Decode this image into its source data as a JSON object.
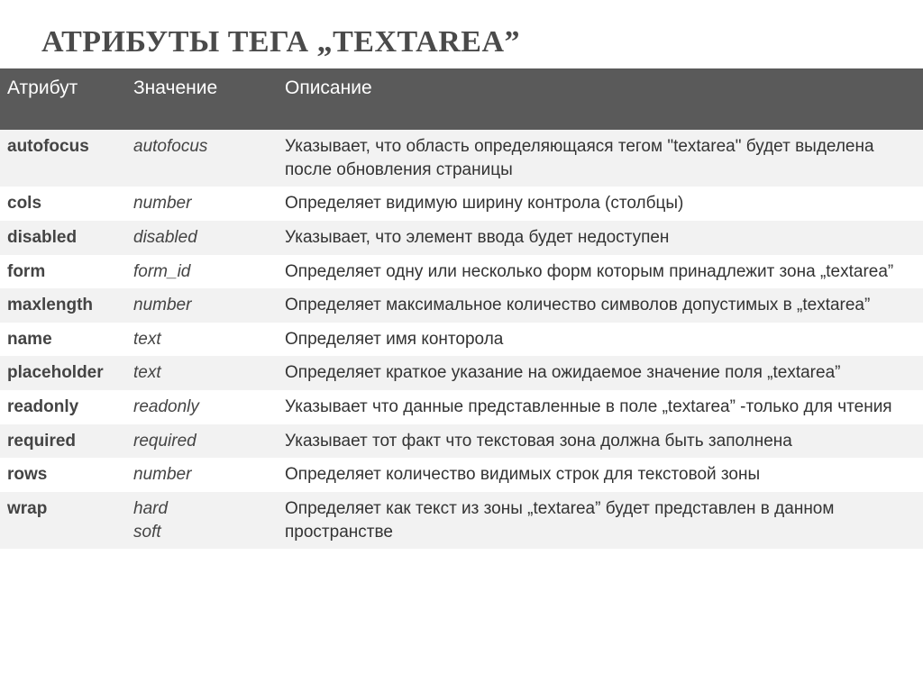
{
  "title": "АТРИБУТЫ ТЕГА „TEXTAREA”",
  "headers": {
    "attribute": "Атрибут",
    "value": "Значение",
    "description": "Описание"
  },
  "rows": [
    {
      "attribute": "autofocus",
      "value": "autofocus",
      "description": "Указывает, что область определяющаяся тегом \"textarea\" будет выделена после обновления страницы"
    },
    {
      "attribute": "cols",
      "value": "number",
      "description": "Определяет видимую ширину контрола (столбцы)"
    },
    {
      "attribute": "disabled",
      "value": "disabled",
      "description": "Указывает, что элемент ввода будет недоступен"
    },
    {
      "attribute": "form",
      "value": "form_id",
      "description": "Определяет одну или несколько форм которым принадлежит зона „textarea”"
    },
    {
      "attribute": "maxlength",
      "value": "number",
      "description": "Определяет максимальное количество символов допустимых в „textarea”"
    },
    {
      "attribute": "name",
      "value": "text",
      "description": "Определяет имя конторола"
    },
    {
      "attribute": "placeholder",
      "value": "text",
      "description": "Определяет краткое указание на ожидаемое значение поля „textarea”"
    },
    {
      "attribute": "readonly",
      "value": "readonly",
      "description": "Указывает что данные представленные в поле „textarea” -только для чтения"
    },
    {
      "attribute": "required",
      "value": "required",
      "description": "Указывает тот факт что текстовая зона должна быть заполнена"
    },
    {
      "attribute": "rows",
      "value": "number",
      "description": "Определяет количество видимых строк для текстовой зоны"
    },
    {
      "attribute": "wrap",
      "value": "hard\nsoft",
      "description": "Определяет как текст из зоны „textarea” будет представлен в данном пространстве"
    }
  ]
}
